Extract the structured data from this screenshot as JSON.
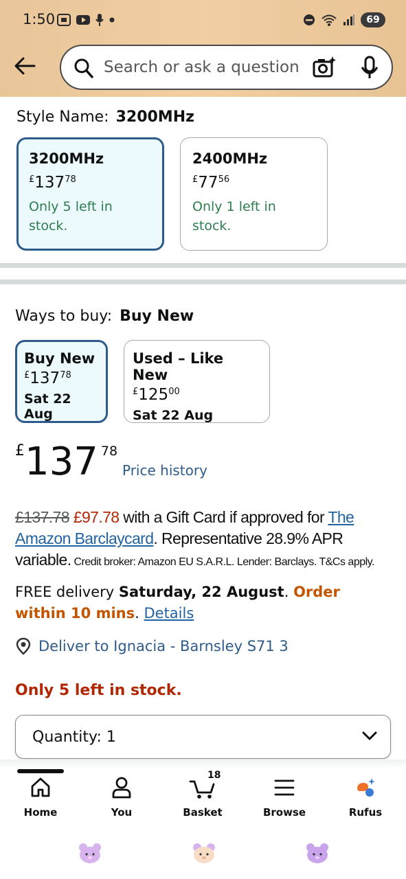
{
  "status_bar": {
    "time": "1:50",
    "battery": "69"
  },
  "header": {
    "search_placeholder": "Search or ask a question"
  },
  "style_section": {
    "label": "Style Name:",
    "selected": "3200MHz",
    "options": [
      {
        "name": "3200MHz",
        "currency": "£",
        "price_whole": "137",
        "price_fraction": "78",
        "stock": "Only 5 left in stock."
      },
      {
        "name": "2400MHz",
        "currency": "£",
        "price_whole": "77",
        "price_fraction": "56",
        "stock": "Only 1 left in stock."
      }
    ]
  },
  "ways_to_buy": {
    "label": "Ways to buy:",
    "selected": "Buy New",
    "options": [
      {
        "name": "Buy New",
        "currency": "£",
        "price_whole": "137",
        "price_fraction": "78",
        "date": "Sat 22 Aug"
      },
      {
        "name": "Used – Like New",
        "currency": "£",
        "price_whole": "125",
        "price_fraction": "00",
        "date": "Sat 22 Aug"
      }
    ]
  },
  "price": {
    "currency": "£",
    "whole": "137",
    "fraction": "78",
    "history_link": "Price history"
  },
  "offer": {
    "old_price": "£137.78",
    "new_price": "£97.78",
    "text1": " with a Gift Card if approved for ",
    "link": "The Amazon Barclaycard",
    "text2": ". Representative 28.9% APR variable.",
    "small": " Credit broker: Amazon EU S.A.R.L. Lender: Barclays. T&Cs apply."
  },
  "delivery": {
    "prefix": "FREE delivery ",
    "date": "Saturday, 22 August",
    "dot": ". ",
    "order_within": "Order within 10 mins",
    "dot2": ". ",
    "details_link": "Details"
  },
  "deliver_to": "Deliver to Ignacia - Barnsley S71 3",
  "stock_warning": "Only 5 left in stock.",
  "quantity": {
    "label": "Quantity:",
    "value": "1"
  },
  "bottom_nav": {
    "items": [
      {
        "label": "Home"
      },
      {
        "label": "You"
      },
      {
        "label": "Basket",
        "count": "18"
      },
      {
        "label": "Browse"
      },
      {
        "label": "Rufus"
      }
    ]
  },
  "colors": {
    "header_bg": "#ecc99b",
    "selected_border": "#2f5b8a",
    "stock_green": "#2e7d4e",
    "price_red": "#b12704",
    "link_blue": "#2162a1",
    "orange": "#c45500"
  }
}
